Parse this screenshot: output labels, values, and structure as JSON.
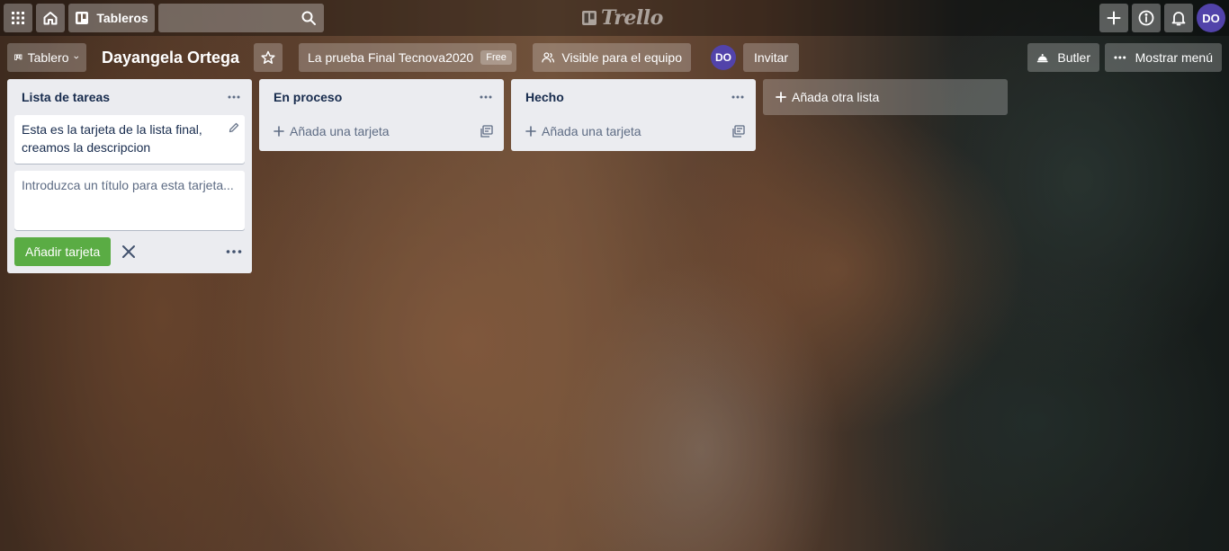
{
  "header": {
    "boards_label": "Tableros",
    "search_placeholder": "",
    "logo_text": "Trello",
    "avatar_initials": "DO"
  },
  "board": {
    "view_switch_label": "Tablero",
    "title": "Dayangela Ortega",
    "team_name": "La prueba Final Tecnova2020",
    "team_badge": "Free",
    "visibility_label": "Visible para el equipo",
    "member_initials": "DO",
    "invite_label": "Invitar",
    "butler_label": "Butler",
    "menu_label": "Mostrar menú"
  },
  "lists": [
    {
      "title": "Lista de tareas",
      "cards": [
        "Esta es la tarjeta de la lista final, creamos la descripcion"
      ],
      "composer_placeholder": "Introduzca un título para esta tarjeta...",
      "composer_submit": "Añadir tarjeta"
    },
    {
      "title": "En proceso",
      "add_card_label": "Añada una tarjeta"
    },
    {
      "title": "Hecho",
      "add_card_label": "Añada una tarjeta"
    }
  ],
  "add_list_label": "Añada otra lista",
  "colors": {
    "accent_green": "#5aac44",
    "avatar_purple": "#5243aa",
    "list_bg": "#ebecf0"
  }
}
